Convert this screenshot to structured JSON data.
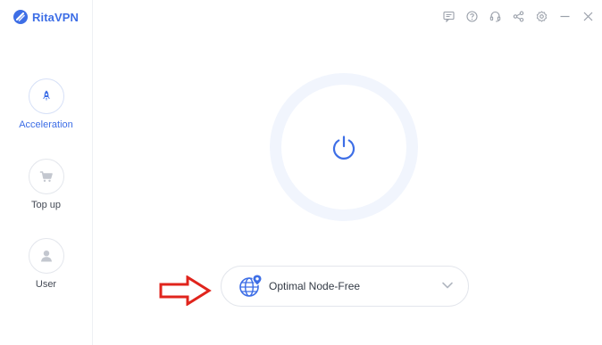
{
  "app": {
    "name": "RitaVPN",
    "brand_color": "#3d6ee6"
  },
  "sidebar": {
    "items": [
      {
        "label": "Acceleration",
        "icon": "rocket-icon",
        "active": true
      },
      {
        "label": "Top up",
        "icon": "cart-icon",
        "active": false
      },
      {
        "label": "User",
        "icon": "user-icon",
        "active": false
      }
    ]
  },
  "titlebar": {
    "icons": [
      "message-icon",
      "help-icon",
      "headset-icon",
      "share-icon",
      "settings-icon",
      "minimize-icon",
      "close-icon"
    ]
  },
  "main": {
    "power_button": {
      "icon": "power-icon",
      "state": "disconnected"
    },
    "node_selector": {
      "label": "Optimal Node-Free",
      "icon": "globe-pin-icon"
    }
  },
  "annotation": {
    "type": "red-arrow",
    "points_to": "node_selector",
    "color": "#e0241c"
  }
}
